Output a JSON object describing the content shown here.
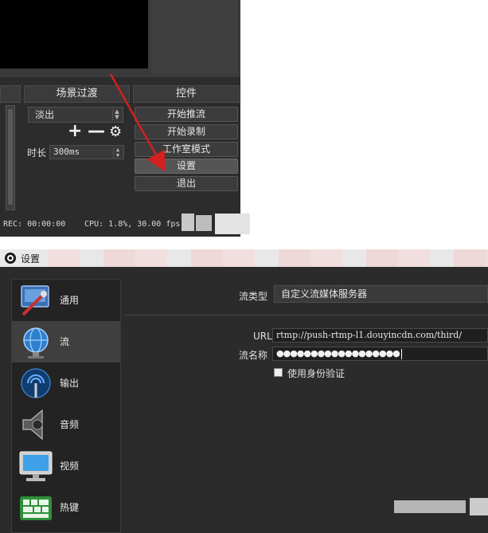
{
  "obs_panel": {
    "headers": {
      "left": "",
      "transition": "场景过渡",
      "controls": "控件"
    },
    "transition_combo": {
      "value": "淡出"
    },
    "transition_tools": {
      "add": "+",
      "remove": "—",
      "settings_icon": "gear-icon"
    },
    "duration": {
      "label": "时长",
      "value": "300ms"
    },
    "controls": {
      "start_stream": "开始推流",
      "start_record": "开始录制",
      "studio_mode": "工作室模式",
      "settings": "设置",
      "exit": "退出"
    },
    "status": {
      "rec": "REC: 00:00:00",
      "cpu": "CPU: 1.8%, 30.00 fps"
    },
    "arrow_color": "#d42020"
  },
  "settings_window": {
    "title": "设置",
    "sidebar": [
      {
        "label": "通用",
        "icon": "general-settings-icon",
        "active": false
      },
      {
        "label": "流",
        "icon": "globe-stream-icon",
        "active": true
      },
      {
        "label": "输出",
        "icon": "output-antenna-icon",
        "active": false
      },
      {
        "label": "音频",
        "icon": "speaker-icon",
        "active": false
      },
      {
        "label": "视频",
        "icon": "monitor-icon",
        "active": false
      },
      {
        "label": "热键",
        "icon": "keyboard-icon",
        "active": false
      }
    ],
    "stream": {
      "type_label": "流类型",
      "type_value": "自定义流媒体服务器",
      "url_label": "URL",
      "url_value": "rtmp://push-rtmp-l1.douyincdn.com/third/",
      "key_label": "流名称",
      "key_value": "●●●●●●●●●●●●●●●●●●",
      "auth_label": "使用身份验证",
      "auth_checked": false
    }
  }
}
